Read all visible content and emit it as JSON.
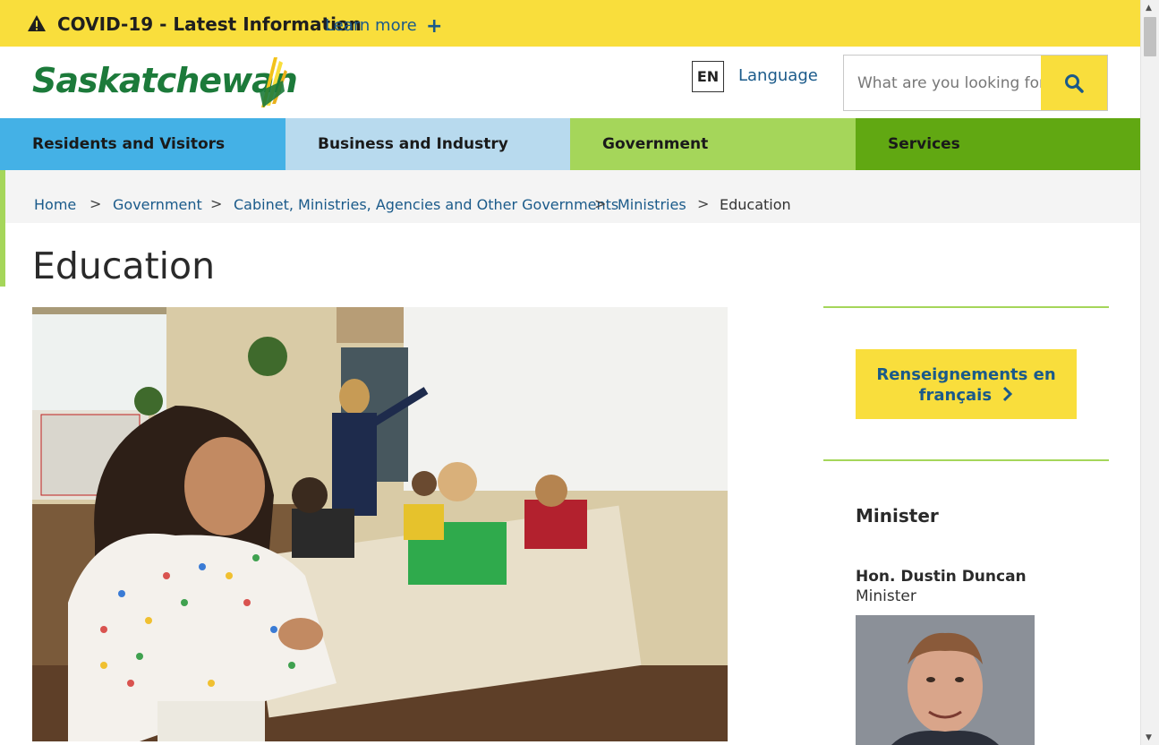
{
  "alert": {
    "title": "COVID-19 - Latest Information",
    "link": "Learn more",
    "expand": "+",
    "icon": "warning-icon"
  },
  "header": {
    "logo_text": "Saskatchewan",
    "language_code": "EN",
    "language_link": "Language",
    "search_placeholder": "What are you looking for?",
    "search_icon": "search-icon"
  },
  "nav": {
    "items": [
      {
        "label": "Residents and Visitors",
        "color": "#44b1e6"
      },
      {
        "label": "Business and Industry",
        "color": "#b8daee"
      },
      {
        "label": "Government",
        "color": "#a5d65a",
        "active": true
      },
      {
        "label": "Services",
        "color": "#61a812"
      }
    ]
  },
  "breadcrumb": {
    "separator": ">",
    "items": [
      "Home",
      "Government",
      "Cabinet, Ministries, Agencies and Other Governments",
      "Ministries",
      "Education"
    ]
  },
  "page": {
    "title": "Education"
  },
  "sidebar": {
    "french_button_line1": "Renseignements en",
    "french_button_line2": "français",
    "minister_heading": "Minister",
    "minister_name": "Hon. Dustin Duncan",
    "minister_role": "Minister"
  },
  "colors": {
    "alert_yellow": "#f9de3c",
    "link_blue": "#1a5a8a",
    "accent_green": "#a5d65a",
    "brand_green": "#1c7a3a"
  }
}
